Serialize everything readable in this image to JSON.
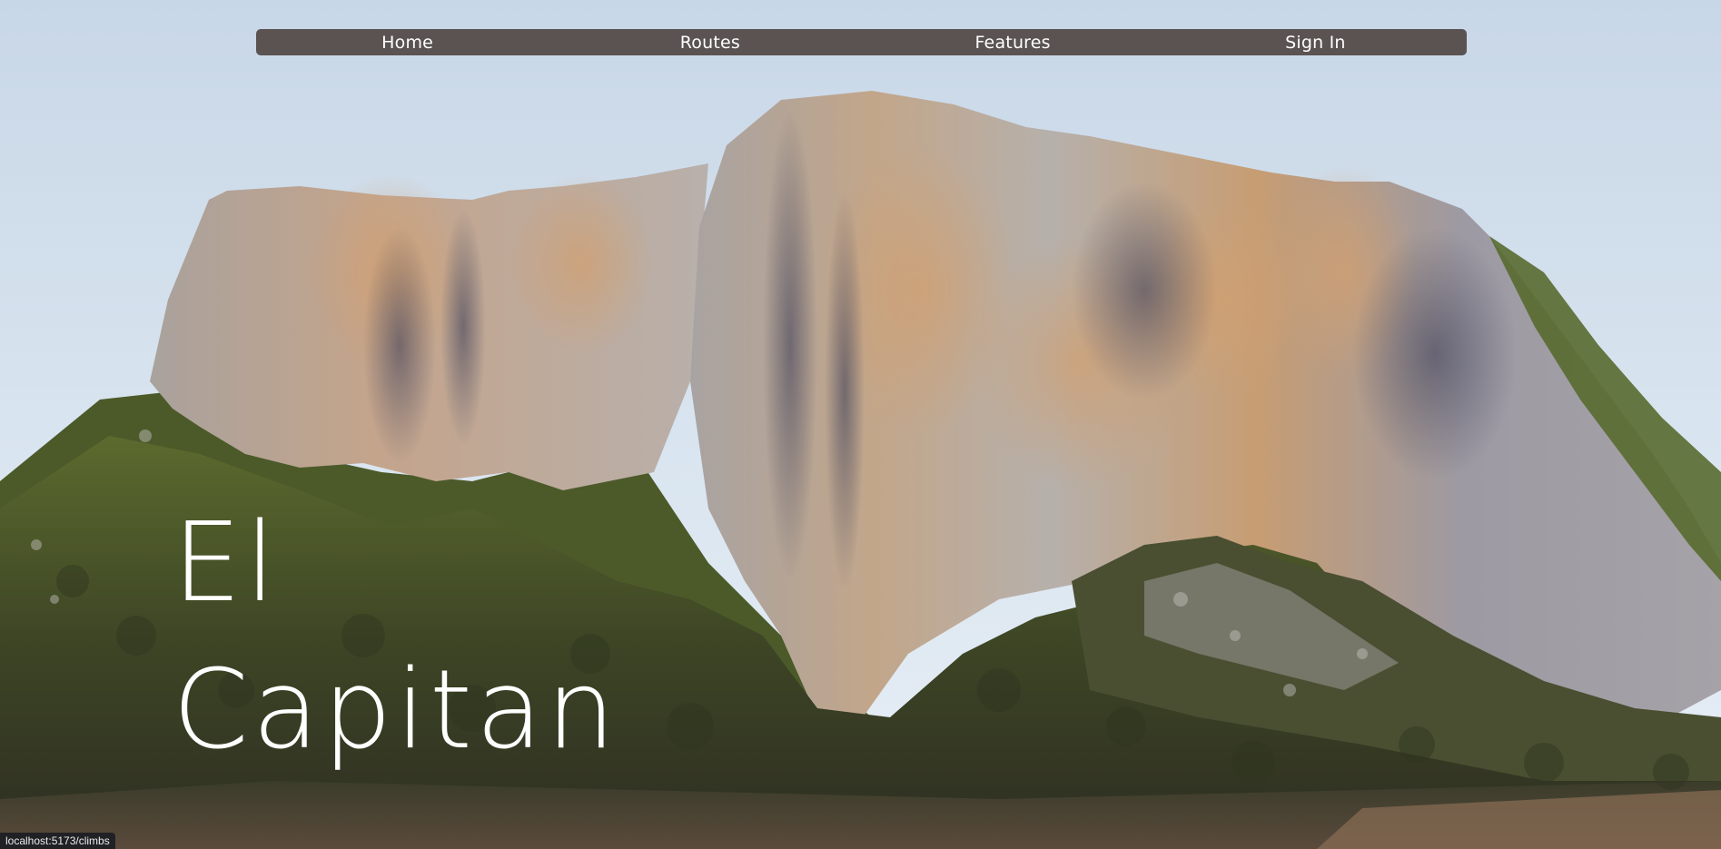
{
  "nav": {
    "items": [
      {
        "label": "Home"
      },
      {
        "label": "Routes"
      },
      {
        "label": "Features"
      },
      {
        "label": "Sign In"
      }
    ]
  },
  "hero": {
    "title_line1": "El",
    "title_line2": "Capitan"
  },
  "status_bar": {
    "url": "localhost:5173/climbs"
  },
  "colors": {
    "nav_background": "#5a5352",
    "sky_top": "#c9d8e7",
    "sky_bottom": "#e6eef5",
    "rock_granite": "#b3aea9",
    "rock_tan": "#c49a6c",
    "forest_green": "#4f5a2c",
    "text": "#ffffff"
  },
  "scene": {
    "image": "3d-terrain-el-capitan-icon"
  }
}
